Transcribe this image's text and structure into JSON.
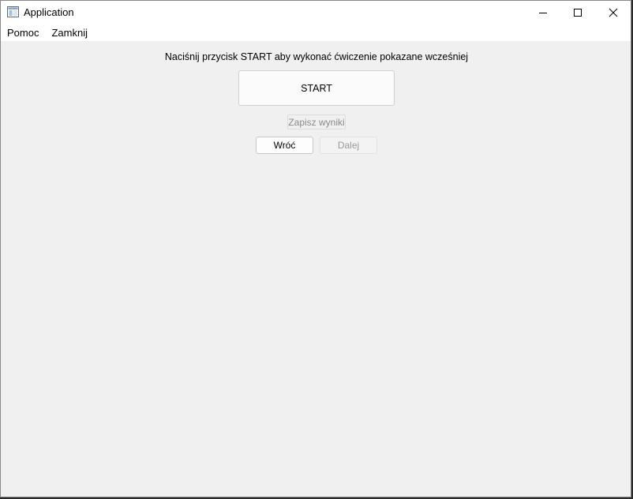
{
  "window": {
    "title": "Application",
    "icon": "app-window-icon",
    "controls": {
      "minimize_icon": "minimize-icon",
      "maximize_icon": "maximize-icon",
      "close_icon": "close-icon"
    }
  },
  "menubar": {
    "items": [
      {
        "label": "Pomoc"
      },
      {
        "label": "Zamknij"
      }
    ]
  },
  "main": {
    "instruction": "Naciśnij przycisk START aby wykonać ćwiczenie pokazane wcześniej",
    "start_label": "START",
    "save_label": "Zapisz wyniki",
    "save_enabled": false,
    "back_label": "Wróć",
    "next_label": "Dalej",
    "next_enabled": false
  },
  "colors": {
    "background": "#f0f0f0",
    "titlebar": "#ffffff",
    "disabled_text": "#8a8a8a"
  }
}
